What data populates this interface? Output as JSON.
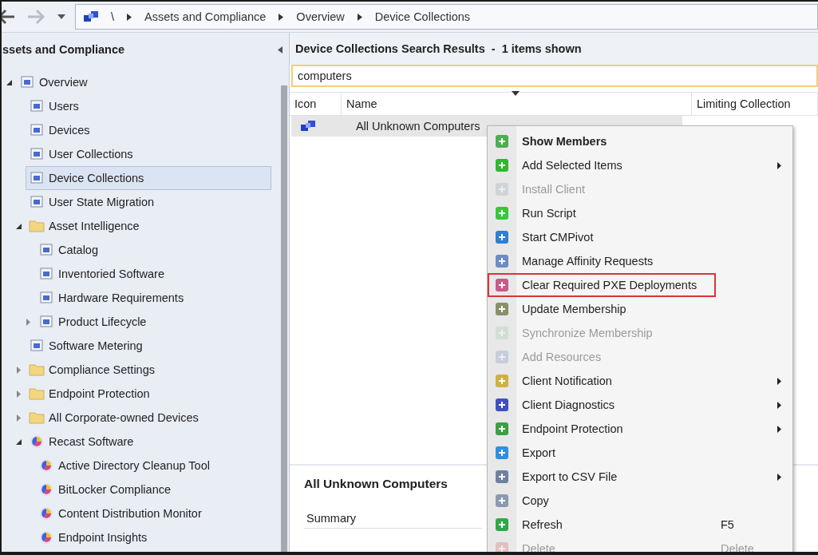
{
  "nav": {
    "breadcrumb": [
      "\\",
      "Assets and Compliance",
      "Overview",
      "Device Collections"
    ]
  },
  "sidebar": {
    "title": "ssets and Compliance",
    "tree": [
      {
        "label": "Overview",
        "kind": "node",
        "expanded": true,
        "selected": false,
        "children": [
          {
            "label": "Users",
            "kind": "node",
            "selected": false
          },
          {
            "label": "Devices",
            "kind": "node",
            "selected": false
          },
          {
            "label": "User Collections",
            "kind": "node",
            "selected": false
          },
          {
            "label": "Device Collections",
            "kind": "node",
            "selected": true
          },
          {
            "label": "User State Migration",
            "kind": "node",
            "selected": false
          },
          {
            "label": "Asset Intelligence",
            "kind": "folder",
            "expanded": true,
            "selected": false,
            "children": [
              {
                "label": "Catalog",
                "kind": "node",
                "selected": false
              },
              {
                "label": "Inventoried Software",
                "kind": "node",
                "selected": false
              },
              {
                "label": "Hardware Requirements",
                "kind": "node",
                "selected": false
              },
              {
                "label": "Product Lifecycle",
                "kind": "node",
                "expanded": false,
                "selected": false
              }
            ]
          },
          {
            "label": "Software Metering",
            "kind": "node",
            "selected": false
          },
          {
            "label": "Compliance Settings",
            "kind": "folder",
            "expanded": false,
            "selected": false
          },
          {
            "label": "Endpoint Protection",
            "kind": "folder",
            "expanded": false,
            "selected": false
          },
          {
            "label": "All Corporate-owned Devices",
            "kind": "folder",
            "expanded": false,
            "selected": false
          },
          {
            "label": "Recast Software",
            "kind": "recast",
            "expanded": true,
            "selected": false,
            "children": [
              {
                "label": "Active Directory Cleanup Tool",
                "kind": "recast",
                "selected": false
              },
              {
                "label": "BitLocker Compliance",
                "kind": "recast",
                "selected": false
              },
              {
                "label": "Content Distribution Monitor",
                "kind": "recast",
                "selected": false
              },
              {
                "label": "Endpoint Insights",
                "kind": "recast",
                "selected": false
              }
            ]
          }
        ]
      }
    ]
  },
  "results": {
    "title": "Device Collections Search Results  -  1 items shown",
    "search": {
      "value": "computers"
    },
    "columns": [
      "Icon",
      "Name",
      "Limiting Collection"
    ],
    "rows": [
      {
        "name": "All Unknown Computers",
        "selected": true
      }
    ]
  },
  "details": {
    "title": "All Unknown Computers",
    "section": "Summary"
  },
  "context_menu": [
    {
      "label": "Show Members",
      "kind": "default",
      "disabled": false,
      "submenu": false,
      "highlighted": false
    },
    {
      "label": "Add Selected Items",
      "kind": "command",
      "disabled": false,
      "submenu": true,
      "highlighted": false
    },
    {
      "label": "Install Client",
      "kind": "command",
      "disabled": true,
      "submenu": false,
      "highlighted": false
    },
    {
      "label": "Run Script",
      "kind": "command",
      "disabled": false,
      "submenu": false,
      "highlighted": false
    },
    {
      "label": "Start CMPivot",
      "kind": "command",
      "disabled": false,
      "submenu": false,
      "highlighted": false
    },
    {
      "label": "Manage Affinity Requests",
      "kind": "command",
      "disabled": false,
      "submenu": false,
      "highlighted": false
    },
    {
      "label": "Clear Required PXE Deployments",
      "kind": "command",
      "disabled": false,
      "submenu": false,
      "highlighted": true
    },
    {
      "label": "Update Membership",
      "kind": "command",
      "disabled": false,
      "submenu": false,
      "highlighted": false
    },
    {
      "label": "Synchronize Membership",
      "kind": "command",
      "disabled": true,
      "submenu": false,
      "highlighted": false
    },
    {
      "label": "Add Resources",
      "kind": "command",
      "disabled": true,
      "submenu": false,
      "highlighted": false
    },
    {
      "label": "Client Notification",
      "kind": "command",
      "disabled": false,
      "submenu": true,
      "highlighted": false
    },
    {
      "label": "Client Diagnostics",
      "kind": "command",
      "disabled": false,
      "submenu": true,
      "highlighted": false
    },
    {
      "label": "Endpoint Protection",
      "kind": "command",
      "disabled": false,
      "submenu": true,
      "highlighted": false
    },
    {
      "label": "Export",
      "kind": "command",
      "disabled": false,
      "submenu": false,
      "highlighted": false
    },
    {
      "label": "Export to CSV File",
      "kind": "command",
      "disabled": false,
      "submenu": true,
      "highlighted": false
    },
    {
      "label": "Copy",
      "kind": "command",
      "disabled": false,
      "submenu": false,
      "highlighted": false
    },
    {
      "label": "Refresh",
      "kind": "command",
      "disabled": false,
      "submenu": false,
      "highlighted": false,
      "shortcut": "F5"
    },
    {
      "label": "Delete",
      "kind": "command",
      "disabled": true,
      "submenu": false,
      "highlighted": false,
      "shortcut": "Delete"
    }
  ]
}
